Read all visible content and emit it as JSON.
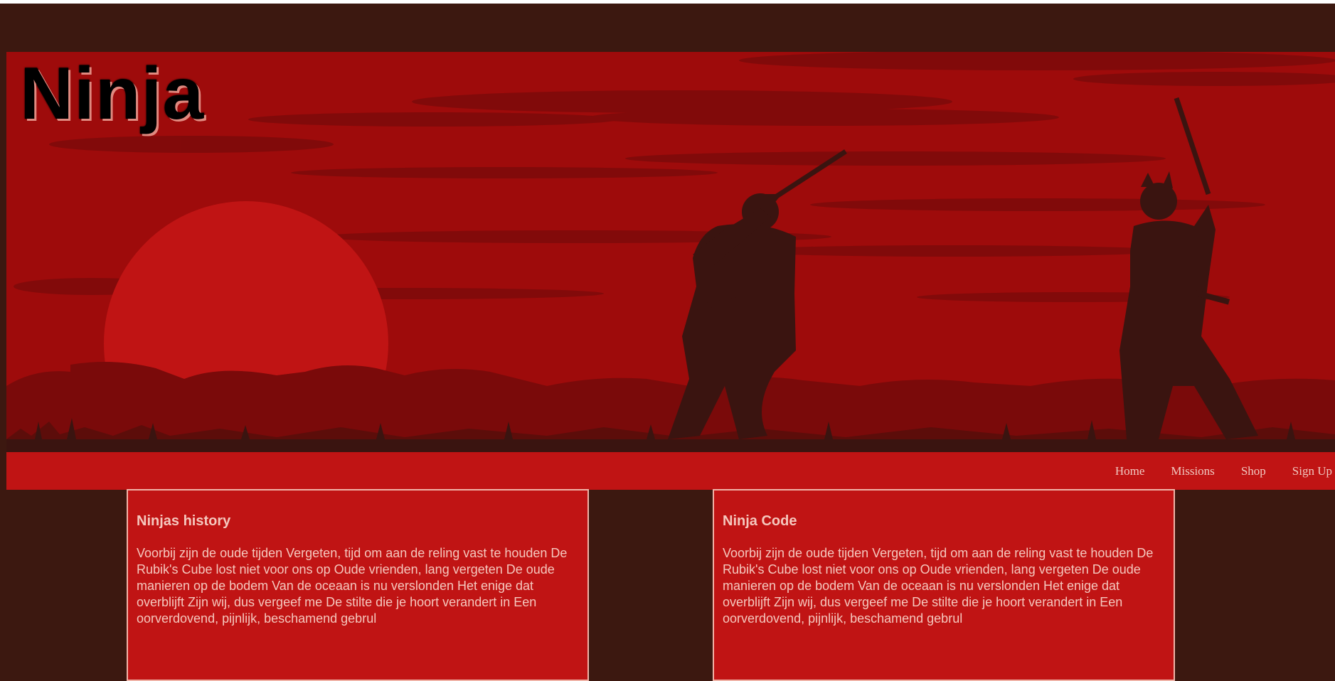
{
  "site": {
    "title": "Ninja"
  },
  "nav": {
    "items": [
      {
        "label": "Home"
      },
      {
        "label": "Missions"
      },
      {
        "label": "Shop"
      },
      {
        "label": "Sign Up"
      }
    ]
  },
  "cards": [
    {
      "heading": "Ninjas history",
      "body": "Voorbij zijn de oude tijden Vergeten, tijd om aan de reling vast te houden De Rubik's Cube lost niet voor ons op Oude vrienden, lang vergeten De oude manieren op de bodem Van de oceaan is nu verslonden Het enige dat overblijft Zijn wij, dus vergeef me De stilte die je hoort verandert in Een oorverdovend, pijnlijk, beschamend gebrul"
    },
    {
      "heading": "Ninja Code",
      "body": "Voorbij zijn de oude tijden Vergeten, tijd om aan de reling vast te houden De Rubik's Cube lost niet voor ons op Oude vrienden, lang vergeten De oude manieren op de bodem Van de oceaan is nu verslonden Het enige dat overblijft Zijn wij, dus vergeef me De stilte die je hoort verandert in Een oorverdovend, pijnlijk, beschamend gebrul"
    }
  ],
  "colors": {
    "page_background": "#3c1810",
    "banner_sky": "#9e0b0b",
    "accent_red": "#c01414",
    "silhouette": "#3a1410",
    "text_light": "#f5c8be"
  }
}
